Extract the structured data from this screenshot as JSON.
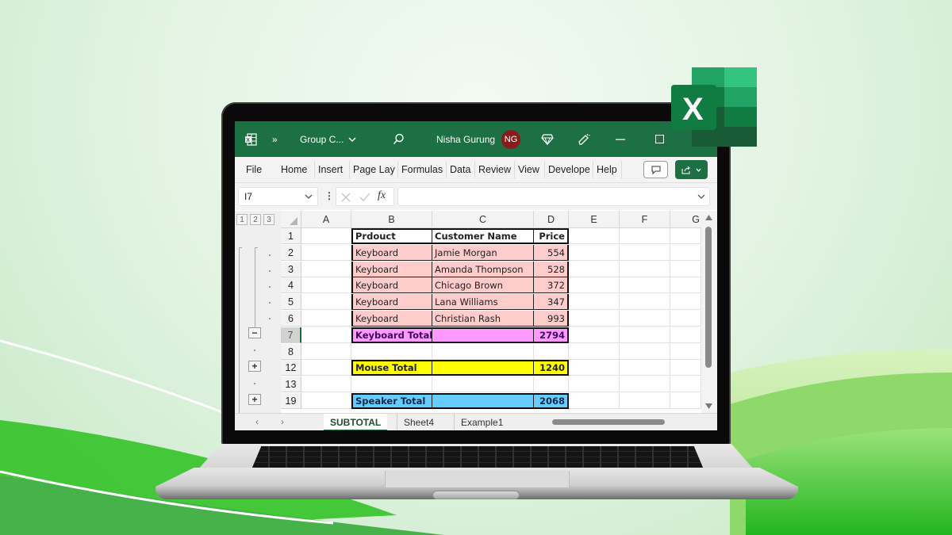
{
  "window": {
    "app_icon": "excel-icon",
    "more_label": "»",
    "doc_title": "Group C...",
    "user_name": "Nisha Gurung",
    "user_initials": "NG",
    "avatar_color": "#8b1a1a",
    "accent_color": "#1d7044"
  },
  "ribbon": {
    "tabs": [
      "File",
      "Home",
      "Insert",
      "Page Lay",
      "Formulas",
      "Data",
      "Review",
      "View",
      "Develope",
      "Help"
    ],
    "comments_icon": "comment-icon",
    "share_icon": "share-icon"
  },
  "formula_bar": {
    "name_box": "I7",
    "fx_label": "fx",
    "formula_value": ""
  },
  "outline": {
    "levels": [
      "1",
      "2",
      "3"
    ],
    "collapse_symbol": "−",
    "expand_symbol": "+"
  },
  "sheet": {
    "columns": [
      "A",
      "B",
      "C",
      "D",
      "E",
      "F",
      "G"
    ],
    "header_row": {
      "row": "1",
      "B": "Prdouct",
      "C": "Customer Name",
      "D": "Price"
    },
    "rows": [
      {
        "row": "2",
        "B": "Keyboard",
        "C": "Jamie Morgan",
        "D": "554"
      },
      {
        "row": "3",
        "B": "Keyboard",
        "C": "Amanda Thompson",
        "D": "528"
      },
      {
        "row": "4",
        "B": "Keyboard",
        "C": "Chicago Brown",
        "D": "372"
      },
      {
        "row": "5",
        "B": "Keyboard",
        "C": "Lana Williams",
        "D": "347"
      },
      {
        "row": "6",
        "B": "Keyboard",
        "C": "Christian Rash",
        "D": "993"
      },
      {
        "row": "7",
        "B": "Keyboard Total",
        "C": "",
        "D": "2794"
      },
      {
        "row": "8",
        "B": "",
        "C": "",
        "D": ""
      },
      {
        "row": "12",
        "B": "Mouse Total",
        "C": "",
        "D": "1240"
      },
      {
        "row": "13",
        "B": "",
        "C": "",
        "D": ""
      },
      {
        "row": "19",
        "B": "Speaker Total",
        "C": "",
        "D": "2068"
      }
    ],
    "fills": {
      "detail": "#ffcccc",
      "keyboard_total": "#ff99ff",
      "mouse_total": "#ffff00",
      "speaker_total": "#66ccff"
    }
  },
  "sheet_tabs": {
    "active": "SUBTOTAL",
    "others": [
      "Sheet4",
      "Example1"
    ]
  }
}
